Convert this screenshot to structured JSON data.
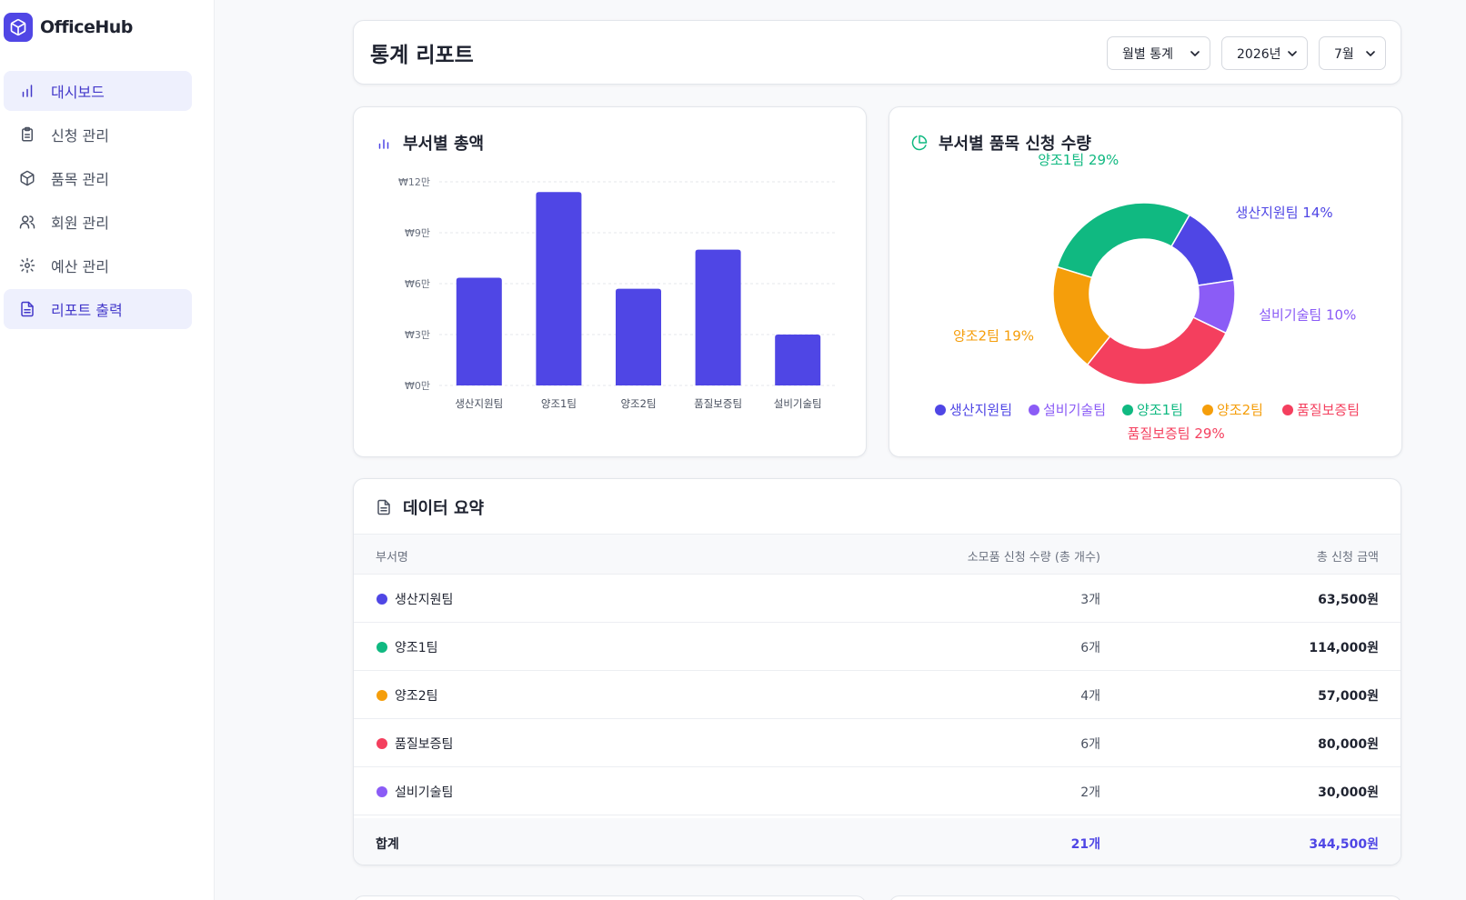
{
  "app": {
    "name": "OfficeHub"
  },
  "sidebar": {
    "items": [
      {
        "label": "대시보드",
        "icon": "bar-chart-icon",
        "active": true
      },
      {
        "label": "신청 관리",
        "icon": "clipboard-icon",
        "active": false
      },
      {
        "label": "품목 관리",
        "icon": "package-icon",
        "active": false
      },
      {
        "label": "회원 관리",
        "icon": "users-icon",
        "active": false
      },
      {
        "label": "예산 관리",
        "icon": "gear-icon",
        "active": false
      },
      {
        "label": "리포트 출력",
        "icon": "file-text-icon",
        "active": true
      }
    ]
  },
  "header": {
    "title": "통계 리포트",
    "filters": {
      "period": "월별 통계",
      "year": "2026년",
      "month": "7월"
    }
  },
  "bar_card": {
    "title": "부서별 총액"
  },
  "pie_card": {
    "title": "부서별 품목 신청 수량"
  },
  "colors": {
    "생산지원팀": "#4f46e5",
    "양조1팀": "#10b981",
    "양조2팀": "#f59e0b",
    "품질보증팀": "#f43f5e",
    "설비기술팀": "#8b5cf6"
  },
  "chart_data": [
    {
      "type": "bar",
      "categories": [
        "생산지원팀",
        "양조1팀",
        "양조2팀",
        "품질보증팀",
        "설비기술팀"
      ],
      "values": [
        63500,
        114000,
        57000,
        80000,
        30000
      ],
      "yticks": [
        "₩0만",
        "₩3만",
        "₩6만",
        "₩9만",
        "₩12만"
      ],
      "ylim": [
        0,
        120000
      ],
      "grid": true,
      "color": "#4f46e5"
    },
    {
      "type": "pie",
      "donut": true,
      "labels": [
        "생산지원팀",
        "설비기술팀",
        "품질보증팀",
        "양조2팀",
        "양조1팀"
      ],
      "values": [
        3,
        2,
        6,
        4,
        6
      ],
      "slice_labels": [
        "생산지원팀 14%",
        "설비기술팀 10%",
        "품질보증팀 29%",
        "양조2팀 19%",
        "양조1팀 29%"
      ],
      "legend": [
        "생산지원팀",
        "설비기술팀",
        "양조1팀",
        "양조2팀",
        "품질보증팀"
      ],
      "legend_position": "bottom"
    }
  ],
  "summary": {
    "title": "데이터 요약",
    "columns": {
      "dept": "부서명",
      "qty": "소모품 신청 수량 (총 개수)",
      "amount": "총 신청 금액"
    },
    "rows": [
      {
        "dept": "생산지원팀",
        "qty": "3개",
        "amount": "63,500원",
        "color": "#4f46e5"
      },
      {
        "dept": "양조1팀",
        "qty": "6개",
        "amount": "114,000원",
        "color": "#10b981"
      },
      {
        "dept": "양조2팀",
        "qty": "4개",
        "amount": "57,000원",
        "color": "#f59e0b"
      },
      {
        "dept": "품질보증팀",
        "qty": "6개",
        "amount": "80,000원",
        "color": "#f43f5e"
      },
      {
        "dept": "설비기술팀",
        "qty": "2개",
        "amount": "30,000원",
        "color": "#8b5cf6"
      }
    ],
    "total": {
      "label": "합계",
      "qty": "21개",
      "amount": "344,500원"
    }
  }
}
